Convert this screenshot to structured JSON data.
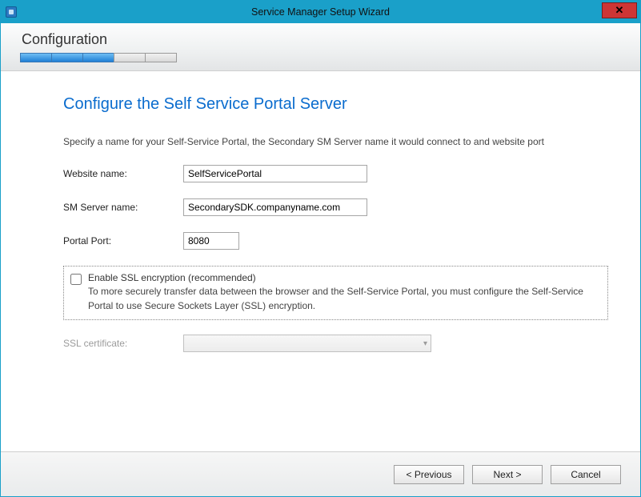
{
  "window": {
    "title": "Service Manager Setup Wizard",
    "close_glyph": "✕"
  },
  "header": {
    "section": "Configuration",
    "progress_total": 5,
    "progress_done": 3
  },
  "page": {
    "heading": "Configure the Self Service Portal Server",
    "description": "Specify a name for your Self-Service Portal, the Secondary SM Server name it would connect to and website port"
  },
  "fields": {
    "website_label": "Website name:",
    "website_value": "SelfServicePortal",
    "smserver_label": "SM Server name:",
    "smserver_value": "SecondarySDK.companyname.com",
    "port_label": "Portal Port:",
    "port_value": "8080"
  },
  "ssl": {
    "enabled": false,
    "line1": "Enable SSL encryption (recommended)",
    "line2": "To more securely transfer data between the browser and the Self-Service Portal, you must configure the Self-Service Portal to use Secure Sockets Layer (SSL) encryption.",
    "cert_label": "SSL certificate:",
    "cert_selected": ""
  },
  "buttons": {
    "previous": "< Previous",
    "next": "Next >",
    "cancel": "Cancel"
  }
}
